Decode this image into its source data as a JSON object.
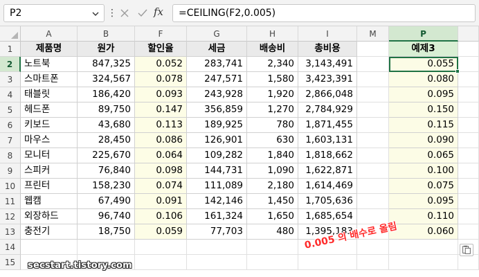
{
  "formula_bar": {
    "name_box": "P2",
    "fx_label": "fx",
    "formula": "=CEILING(F2,0.005)"
  },
  "columns": [
    "A",
    "B",
    "F",
    "G",
    "H",
    "I",
    "M",
    "P"
  ],
  "rows": [
    "1",
    "2",
    "3",
    "4",
    "5",
    "6",
    "7",
    "8",
    "9",
    "10",
    "11",
    "12",
    "13",
    "14",
    "15"
  ],
  "table": {
    "headers": [
      "제품명",
      "원가",
      "할인율",
      "세금",
      "배송비",
      "총비용"
    ],
    "rows": [
      [
        "노트북",
        "847,325",
        "0.052",
        "283,741",
        "2,340",
        "3,143,491"
      ],
      [
        "스마트폰",
        "324,567",
        "0.078",
        "247,571",
        "1,580",
        "3,423,391"
      ],
      [
        "태블릿",
        "186,420",
        "0.093",
        "243,928",
        "1,920",
        "2,866,048"
      ],
      [
        "헤드폰",
        "89,750",
        "0.147",
        "356,859",
        "1,270",
        "2,784,929"
      ],
      [
        "키보드",
        "43,680",
        "0.113",
        "189,925",
        "780",
        "1,871,455"
      ],
      [
        "마우스",
        "28,450",
        "0.086",
        "126,901",
        "630",
        "1,603,131"
      ],
      [
        "모니터",
        "225,670",
        "0.064",
        "109,282",
        "1,840",
        "1,818,662"
      ],
      [
        "스피커",
        "76,840",
        "0.098",
        "144,731",
        "1,090",
        "1,622,871"
      ],
      [
        "프린터",
        "158,230",
        "0.074",
        "111,089",
        "2,180",
        "1,614,469"
      ],
      [
        "웹캠",
        "67,490",
        "0.091",
        "142,146",
        "1,450",
        "1,705,636"
      ],
      [
        "외장하드",
        "96,740",
        "0.106",
        "161,324",
        "1,650",
        "1,685,654"
      ],
      [
        "충전기",
        "18,750",
        "0.059",
        "77,703",
        "480",
        "1,395,183"
      ]
    ]
  },
  "result": {
    "header": "예제3",
    "values": [
      "0.055",
      "0.080",
      "0.095",
      "0.150",
      "0.115",
      "0.090",
      "0.065",
      "0.100",
      "0.075",
      "0.095",
      "0.110",
      "0.060"
    ]
  },
  "annotation": "0.005 의 배수로 올림",
  "watermark": "secstart.tistory.com",
  "colors": {
    "accent": "#217346",
    "header_fill": "#eaeaea",
    "result_header_fill": "#d9efd4",
    "discount_fill": "#fdfde6",
    "annotation": "#ff2a2a"
  },
  "icons": [
    "chevron-down-icon",
    "more-options-icon",
    "cancel-icon",
    "enter-icon",
    "insert-function-icon",
    "paste-options-icon"
  ]
}
